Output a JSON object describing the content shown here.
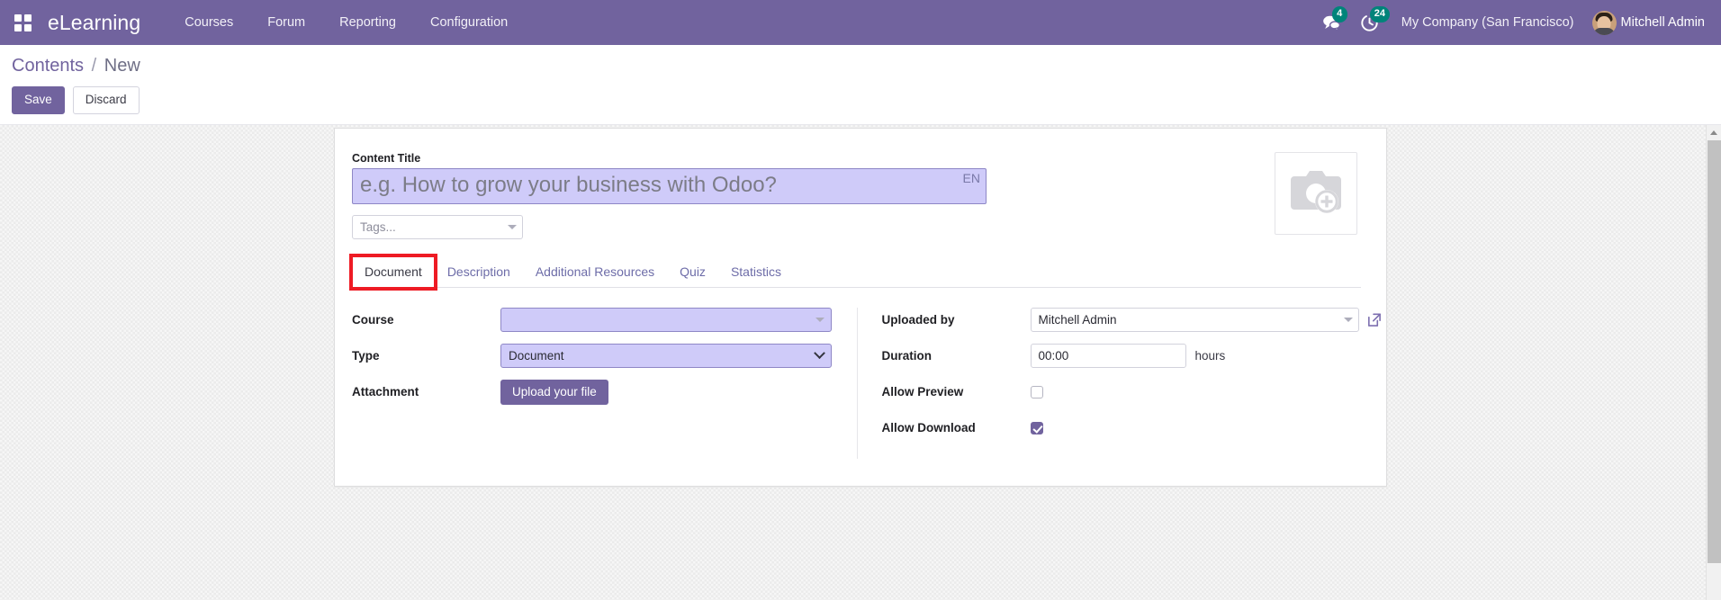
{
  "navbar": {
    "apps_icon": "apps-grid-icon",
    "brand": "eLearning",
    "menu": [
      {
        "label": "Courses"
      },
      {
        "label": "Forum"
      },
      {
        "label": "Reporting"
      },
      {
        "label": "Configuration"
      }
    ],
    "messages": {
      "icon": "chat-bubble-icon",
      "count": "4"
    },
    "activities": {
      "icon": "clock-activity-icon",
      "count": "24"
    },
    "company": "My Company (San Francisco)",
    "user": {
      "name": "Mitchell Admin",
      "avatar": "user-avatar"
    }
  },
  "control_panel": {
    "breadcrumb_root": "Contents",
    "breadcrumb_sep": "/",
    "breadcrumb_current": "New",
    "save_label": "Save",
    "discard_label": "Discard"
  },
  "form": {
    "content_title_label": "Content Title",
    "content_title_value": "",
    "content_title_placeholder": "e.g. How to grow your business with Odoo?",
    "language_badge": "EN",
    "tags_placeholder": "Tags...",
    "image_upload_icon": "camera-plus-icon",
    "tabs": [
      {
        "label": "Document",
        "active": true,
        "highlighted": true
      },
      {
        "label": "Description",
        "active": false,
        "highlighted": false
      },
      {
        "label": "Additional Resources",
        "active": false,
        "highlighted": false
      },
      {
        "label": "Quiz",
        "active": false,
        "highlighted": false
      },
      {
        "label": "Statistics",
        "active": false,
        "highlighted": false
      }
    ],
    "left_fields": {
      "course_label": "Course",
      "course_value": "",
      "type_label": "Type",
      "type_value": "Document",
      "attachment_label": "Attachment",
      "attachment_button": "Upload your file"
    },
    "right_fields": {
      "uploaded_by_label": "Uploaded by",
      "uploaded_by_value": "Mitchell Admin",
      "external_link_icon": "external-link-icon",
      "duration_label": "Duration",
      "duration_value": "00:00",
      "duration_unit": "hours",
      "allow_preview_label": "Allow Preview",
      "allow_preview_checked": false,
      "allow_download_label": "Allow Download",
      "allow_download_checked": true
    }
  },
  "colors": {
    "brand_purple": "#71639e",
    "badge_teal": "#00847a",
    "highlight_red": "#ee1b24",
    "focus_field_bg": "#cfcbf9"
  }
}
